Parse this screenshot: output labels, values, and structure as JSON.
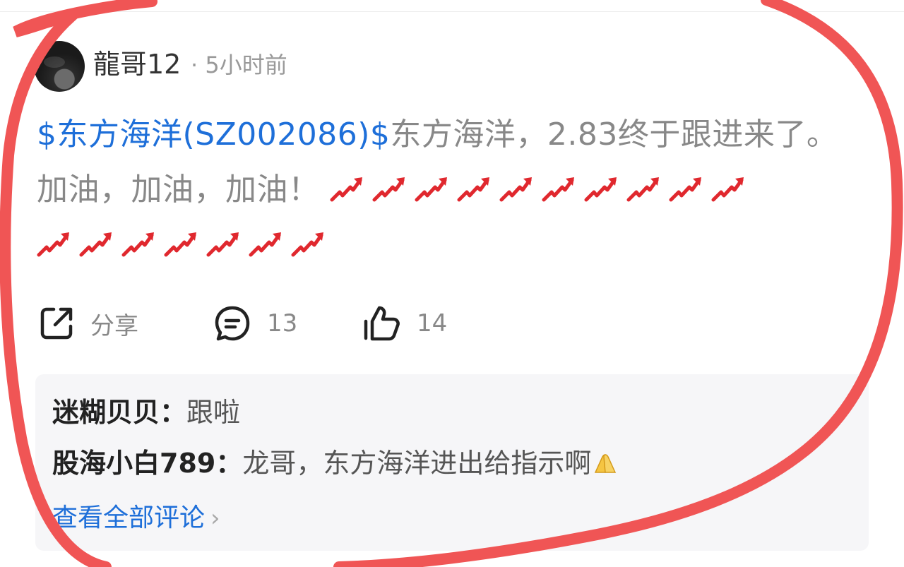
{
  "post": {
    "author": "龍哥12",
    "meta": "· 5小时前",
    "stock_tag": "$东方海洋(SZ002086)$",
    "body_text": "东方海洋，2.83终于跟进来了。加油，加油，加油！",
    "rocket_icon": "chart-increasing-icon",
    "rockets_row1": 10,
    "rockets_row2": 7
  },
  "actions": {
    "share_label": "分享",
    "comment_count": "13",
    "like_count": "14"
  },
  "comments": {
    "items": [
      {
        "name": "迷糊贝贝：",
        "text": "跟啦"
      },
      {
        "name": "股海小白789：",
        "text": "龙哥，东方海洋进出给指示啊"
      }
    ],
    "view_all": "查看全部评论",
    "chevron": "›"
  },
  "colors": {
    "link_blue": "#1e6fd9",
    "annotation_red": "#f05555",
    "comment_bg": "#f6f6f8"
  }
}
